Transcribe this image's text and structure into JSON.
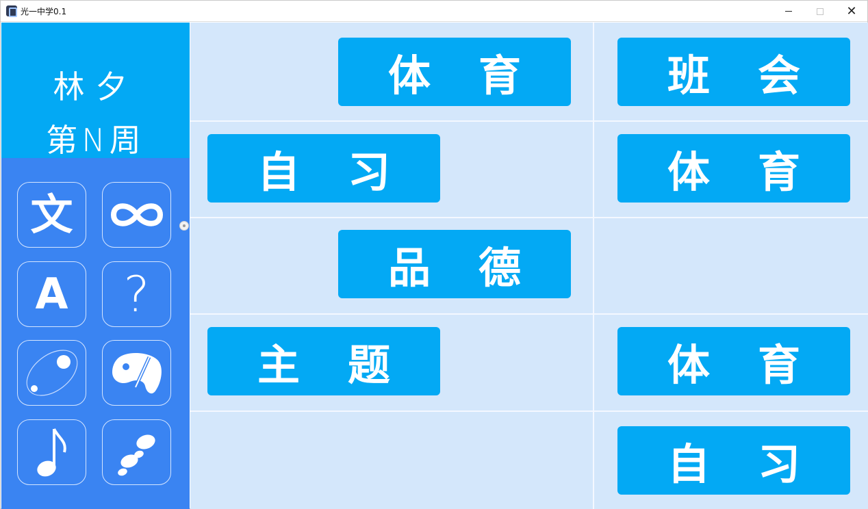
{
  "window": {
    "title": "光一中学0.1",
    "controls": {
      "close": "✕"
    }
  },
  "sidebar": {
    "student_name": "林夕",
    "week": "第N周",
    "tiles": [
      {
        "label": "文",
        "icon": "chinese-character-icon"
      },
      {
        "icon": "infinity-icon"
      },
      {
        "label": "A",
        "icon": "letter-a-icon"
      },
      {
        "label": "?",
        "icon": "question-mark-icon"
      },
      {
        "icon": "orbit-icon"
      },
      {
        "icon": "paint-palette-icon"
      },
      {
        "icon": "music-note-icon"
      },
      {
        "icon": "footprints-icon"
      }
    ]
  },
  "schedule": {
    "cells": [
      {
        "chars": [
          "体",
          "育"
        ]
      },
      {
        "chars": [
          "班",
          "会"
        ]
      },
      {
        "chars": [
          "自",
          "习"
        ]
      },
      {
        "chars": [
          "体",
          "育"
        ]
      },
      {
        "chars": [
          "品",
          "德"
        ]
      },
      {
        "chars": [
          "主",
          "题"
        ]
      },
      {
        "chars": [
          "体",
          "育"
        ]
      },
      {
        "chars": [
          "自",
          "习"
        ]
      }
    ]
  },
  "colors": {
    "accent": "#03a9f4",
    "sidebar_bottom": "#3a84f2",
    "schedule_background": "#d4e7fb",
    "text_on_accent": "#ffffff"
  }
}
